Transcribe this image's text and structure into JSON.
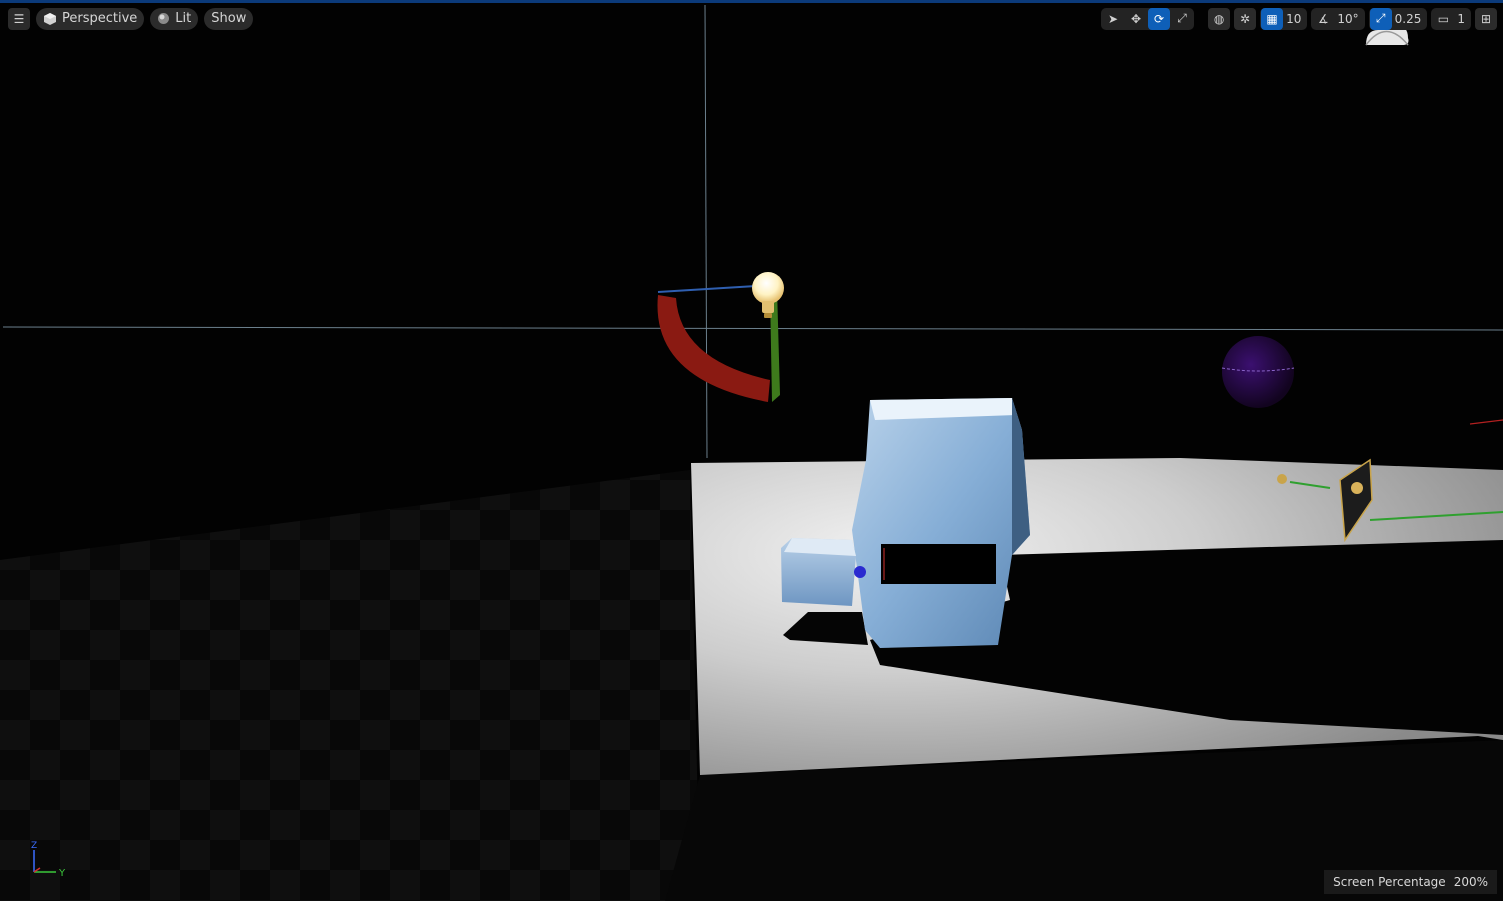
{
  "toolbar": {
    "menu_icon": "hamburger-icon",
    "perspective_label": "Perspective",
    "view_mode_label": "Lit",
    "show_label": "Show",
    "grid_snap_value": "10",
    "rotation_snap_value": "10°",
    "scale_snap_value": "0.25",
    "camera_speed_value": "1"
  },
  "overlay": {
    "screen_percentage_label": "Screen Percentage",
    "screen_percentage_value": "200%"
  },
  "axis_gizmo": {
    "z_label": "Z",
    "y_label": "Y"
  },
  "colors": {
    "accent": "#0e5fb8",
    "toolbar_bg": "#2b2b2b",
    "axis_x": "#d03030",
    "axis_y": "#3cc83c",
    "axis_z": "#3a6cff"
  }
}
